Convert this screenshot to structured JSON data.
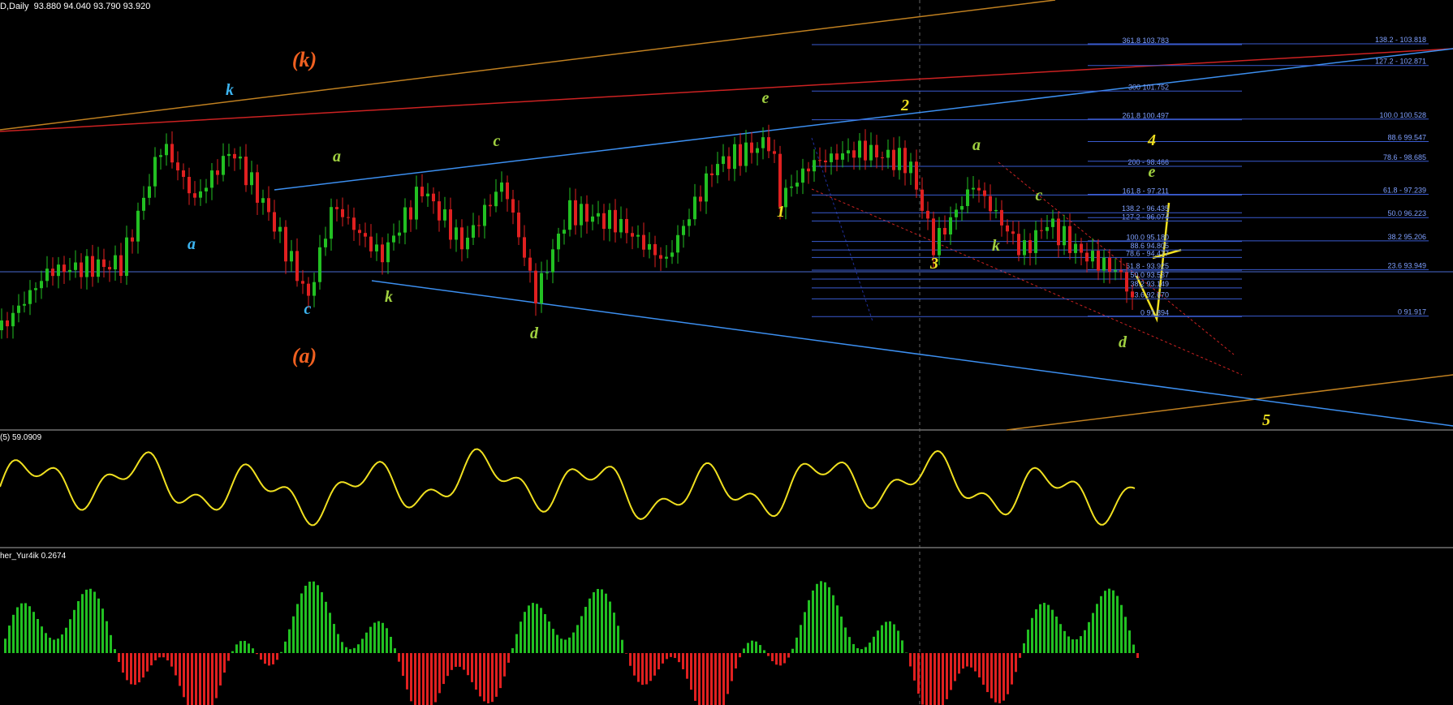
{
  "header": {
    "symbol": "D,Daily",
    "ohlc": "93.880 94.040 93.790 93.920"
  },
  "panels": {
    "oscillator_label": "(5) 59.0909",
    "histogram_label": "her_Yur4ik 0.2674"
  },
  "colors": {
    "background": "#000000",
    "bull_candle": "#22c022",
    "bear_candle": "#e02020",
    "fib_line": "#3a5bd0",
    "channel_blue": "#3c8ff0",
    "channel_red": "#cc2222",
    "channel_orange": "#c08020",
    "wave_orange": "#f06020",
    "wave_cyan": "#3cb4f0",
    "wave_green": "#a0d040",
    "wave_yellow": "#f0e020"
  },
  "chart_data": [
    {
      "type": "candlestick",
      "title": "D,Daily",
      "ylim": [
        90.0,
        105.0
      ],
      "fib_levels_left": [
        {
          "label": "361.8 103.783",
          "value": 103.783
        },
        {
          "label": "300 101.752",
          "value": 101.752
        },
        {
          "label": "261.8 100.497",
          "value": 100.497
        },
        {
          "label": "200 - 98.466",
          "value": 98.466
        },
        {
          "label": "161.8 - 97.211",
          "value": 97.211
        },
        {
          "label": "138.2 - 96.435",
          "value": 96.435
        },
        {
          "label": "127.2 - 96.074",
          "value": 96.074
        },
        {
          "label": "100.0 95.180",
          "value": 95.18
        },
        {
          "label": "88.6 94.805",
          "value": 94.805
        },
        {
          "label": "78.6 - 94.477",
          "value": 94.477
        },
        {
          "label": "61.8 - 93.925",
          "value": 93.925
        },
        {
          "label": "50.0 93.537",
          "value": 93.537
        },
        {
          "label": "38.2 93.149",
          "value": 93.149
        },
        {
          "label": "23.6 92.670",
          "value": 92.67
        },
        {
          "label": "0 91.894",
          "value": 91.894
        }
      ],
      "fib_levels_right": [
        {
          "label": "138.2 - 103.818",
          "value": 103.818
        },
        {
          "label": "127.2 - 102.871",
          "value": 102.871
        },
        {
          "label": "100.0 100.528",
          "value": 100.528
        },
        {
          "label": "88.6 99.547",
          "value": 99.547
        },
        {
          "label": "78.6 - 98.685",
          "value": 98.685
        },
        {
          "label": "61.8 - 97.239",
          "value": 97.239
        },
        {
          "label": "50.0 96.223",
          "value": 96.223
        },
        {
          "label": "38.2 95.206",
          "value": 95.206
        },
        {
          "label": "23.6 93.949",
          "value": 93.949
        },
        {
          "label": "0 91.917",
          "value": 91.917
        }
      ],
      "wave_labels": [
        {
          "text": "(k)",
          "color": "wave_orange"
        },
        {
          "text": "(a)",
          "color": "wave_orange"
        },
        {
          "text": "k",
          "color": "wave_cyan"
        },
        {
          "text": "a",
          "color": "wave_cyan"
        },
        {
          "text": "c",
          "color": "wave_cyan"
        },
        {
          "text": "a",
          "color": "wave_green"
        },
        {
          "text": "c",
          "color": "wave_green"
        },
        {
          "text": "k",
          "color": "wave_green"
        },
        {
          "text": "d",
          "color": "wave_green"
        },
        {
          "text": "e",
          "color": "wave_green"
        },
        {
          "text": "1",
          "color": "wave_yellow"
        },
        {
          "text": "2",
          "color": "wave_yellow"
        },
        {
          "text": "3",
          "color": "wave_yellow"
        },
        {
          "text": "4",
          "color": "wave_yellow"
        },
        {
          "text": "5",
          "color": "wave_yellow"
        },
        {
          "text": "a",
          "color": "wave_green"
        },
        {
          "text": "c",
          "color": "wave_green"
        },
        {
          "text": "k",
          "color": "wave_green"
        },
        {
          "text": "d",
          "color": "wave_green"
        },
        {
          "text": "e",
          "color": "wave_green"
        }
      ]
    },
    {
      "type": "line",
      "title": "(5) 59.0909",
      "last_value": 59.0909
    },
    {
      "type": "bar",
      "title": "her_Yur4ik 0.2674",
      "last_value": 0.2674
    }
  ]
}
